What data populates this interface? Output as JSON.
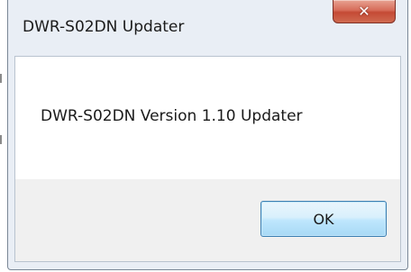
{
  "window": {
    "title": "DWR-S02DN Updater",
    "close_icon": "close-icon"
  },
  "dialog": {
    "message": "DWR-S02DN Version 1.10 Updater",
    "ok_label": "OK"
  }
}
